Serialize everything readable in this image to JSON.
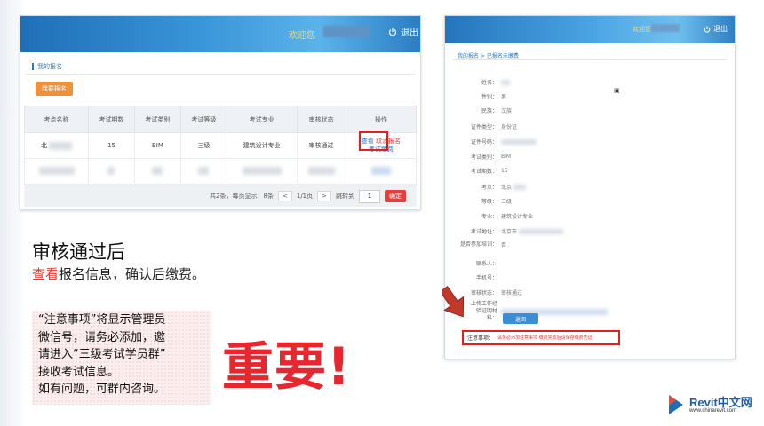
{
  "left_panel": {
    "header": {
      "welcome": "欢迎您",
      "logout": "退出"
    },
    "breadcrumb": "我的报名",
    "apply_button": "我要报名",
    "table": {
      "columns": [
        "考点名称",
        "考试期数",
        "考试类别",
        "考试等级",
        "考试专业",
        "审核状态",
        "操作"
      ],
      "row1": {
        "site": "北",
        "period": "15",
        "category": "BIM",
        "level": "三级",
        "major": "建筑设计专业",
        "status": "审核通过",
        "view": "查看",
        "cancel": "取消报名",
        "pay": "考试缴费"
      }
    },
    "pager": {
      "summary": "共2条，每页显示：8条",
      "prev": "<",
      "page": "1/1页",
      "next": ">",
      "jump_label": "跳转到",
      "jump_value": "1",
      "confirm": "确定"
    }
  },
  "right_panel": {
    "header": {
      "welcome": "欢迎您",
      "logout": "退出"
    },
    "breadcrumb": "我的报名 > 已报名未缴费",
    "fields": [
      {
        "label": "姓名：",
        "value": ""
      },
      {
        "label": "性别：",
        "value": "男"
      },
      {
        "label": "民族：",
        "value": "汉族"
      },
      {
        "label": "证件类型：",
        "value": "身份证"
      },
      {
        "label": "证件号码：",
        "value": ""
      },
      {
        "label": "考试类别：",
        "value": "BIM"
      },
      {
        "label": "考试期数：",
        "value": "15"
      },
      {
        "label": "考点：",
        "value": "北京"
      },
      {
        "label": "等级：",
        "value": "三级"
      },
      {
        "label": "专业：",
        "value": "建筑设计专业"
      },
      {
        "label": "考试地址：",
        "value": "北京市"
      },
      {
        "label": "是否参加培训：",
        "value": "否"
      },
      {
        "label": "联系人：",
        "value": ""
      },
      {
        "label": "手机号：",
        "value": ""
      },
      {
        "label": "审核状态：",
        "value": "审核通过"
      },
      {
        "label": "上传工作经验证明材料：",
        "value": ""
      }
    ],
    "back_button": "返回",
    "notice_label": "注意事项：",
    "notice_text": "请务必添加注意事项 缴费完成后请保存缴费凭证"
  },
  "caption": {
    "title": "审核通过后",
    "line_red": "查看",
    "line_rest": "报名信息，确认后缴费。",
    "note_lines": [
      "“注意事项”将显示管理员",
      "微信号，请务必添加，邀",
      "请进入“三级考试学员群”",
      "接收考试信息。",
      "如有问题，可群内咨询。"
    ],
    "important": "重要!"
  },
  "logo": {
    "main": "Revit中文网",
    "url": "www.chinarevit.com"
  },
  "colors": {
    "accent_red": "#e8262e",
    "banner_blue": "#2a7fc6",
    "apply_orange": "#f0913a"
  }
}
